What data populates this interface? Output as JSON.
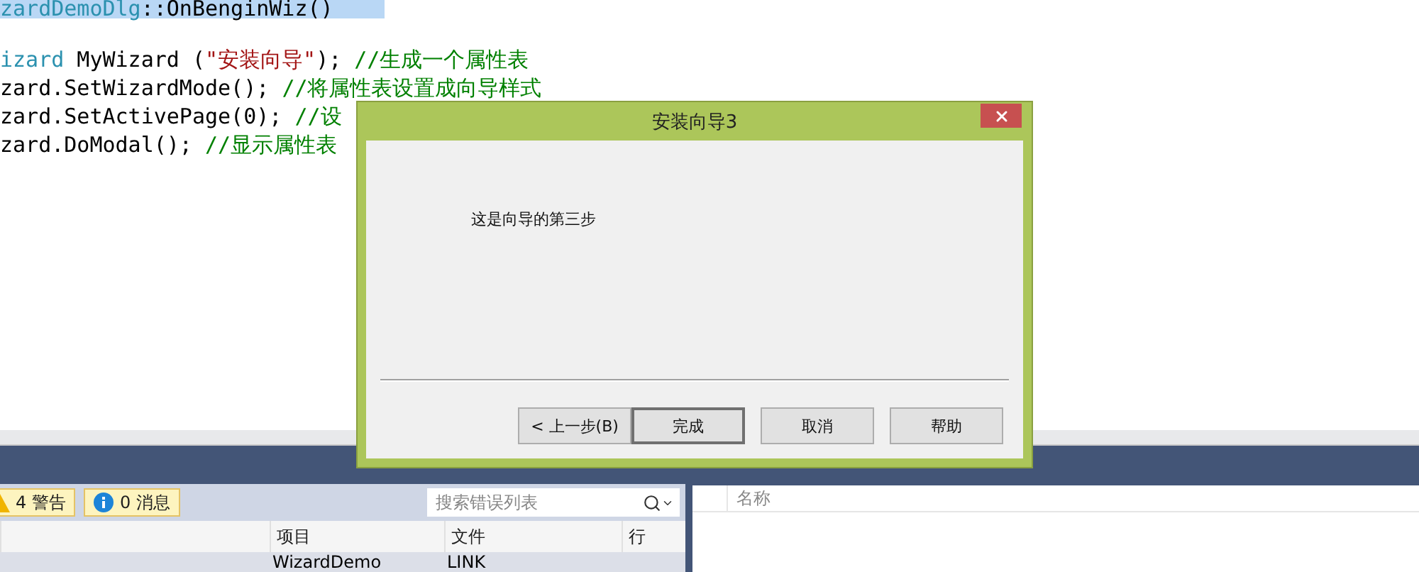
{
  "editor": {
    "lines": [
      {
        "highlighted": true,
        "segments": [
          {
            "kind": "type",
            "text": "zardDemoDlg"
          },
          {
            "kind": "plain",
            "text": "::OnBenginWiz()"
          }
        ]
      },
      {
        "highlighted": false,
        "segments": [
          {
            "kind": "type",
            "text": "izard"
          },
          {
            "kind": "plain",
            "text": " MyWizard ("
          },
          {
            "kind": "string",
            "text": "\"安装向导\""
          },
          {
            "kind": "plain",
            "text": "); "
          },
          {
            "kind": "comment",
            "text": "//生成一个属性表"
          }
        ]
      },
      {
        "highlighted": false,
        "segments": [
          {
            "kind": "plain",
            "text": "zard.SetWizardMode(); "
          },
          {
            "kind": "comment",
            "text": "//将属性表设置成向导样式"
          }
        ]
      },
      {
        "highlighted": false,
        "segments": [
          {
            "kind": "plain",
            "text": "zard.SetActivePage(0); "
          },
          {
            "kind": "comment",
            "text": "//设"
          }
        ]
      },
      {
        "highlighted": false,
        "segments": [
          {
            "kind": "plain",
            "text": "zard.DoModal(); "
          },
          {
            "kind": "comment",
            "text": "//显示属性表"
          }
        ]
      }
    ]
  },
  "dialog": {
    "title": "安装向导3",
    "message": "这是向导的第三步",
    "buttons": [
      {
        "label": "< 上一步(B)",
        "default": false
      },
      {
        "label": "完成",
        "default": true
      },
      {
        "label": "取消",
        "default": false
      },
      {
        "label": "帮助",
        "default": false
      }
    ]
  },
  "error_list": {
    "filters": [
      {
        "kind": "warning",
        "label": "4 警告",
        "selected": true
      },
      {
        "kind": "info",
        "label": "0 消息",
        "selected": true
      }
    ],
    "search": {
      "placeholder": "搜索错误列表"
    },
    "columns": [
      "项目",
      "文件",
      "行"
    ],
    "rows": [
      {
        "project": "WizardDemo",
        "file": "LINK"
      }
    ]
  },
  "output_panel": {
    "columns": [
      "名称"
    ]
  }
}
